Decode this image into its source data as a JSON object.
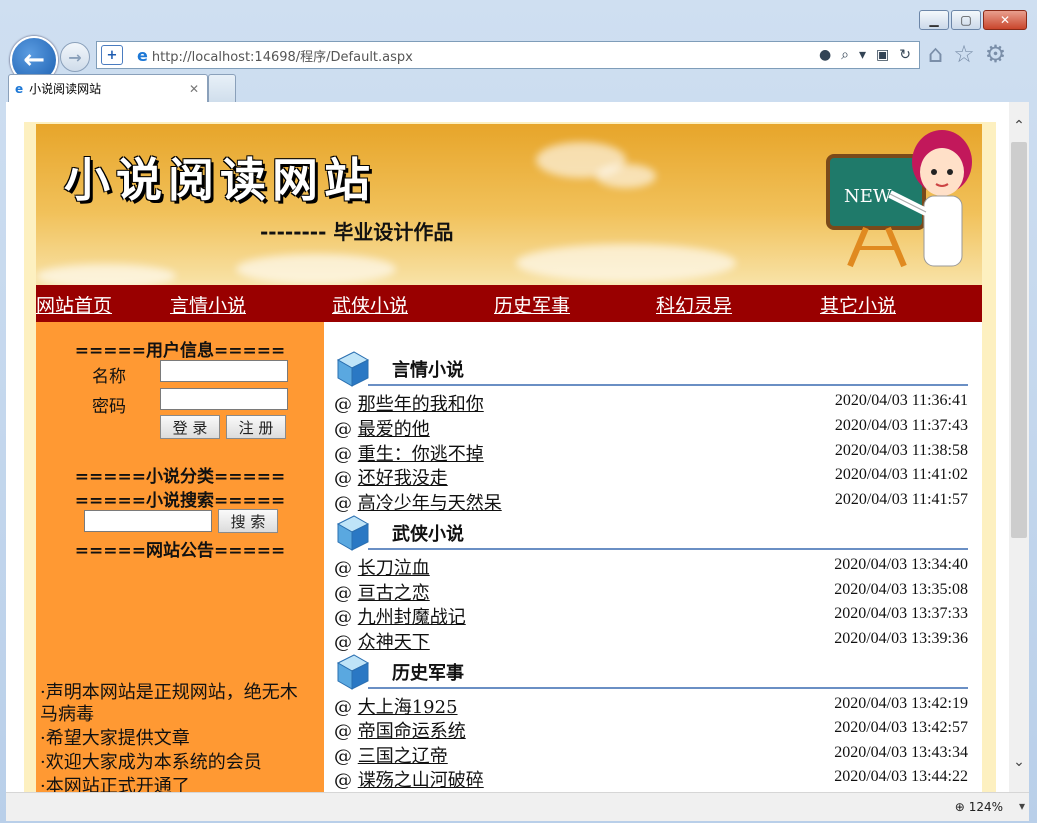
{
  "browser": {
    "url": "http://localhost:14698/程序/Default.aspx",
    "tab_title": "小说阅读网站",
    "zoom": "124%"
  },
  "site": {
    "title": "小说阅读网站",
    "subtitle": "-------- 毕业设计作品",
    "board_text": "NEW"
  },
  "menu": [
    "网站首页",
    "言情小说",
    "武侠小说",
    "历史军事",
    "科幻灵异",
    "其它小说"
  ],
  "sidebar": {
    "user_heading": "=====用户信息=====",
    "name_label": "名称",
    "password_label": "密码",
    "login_button": "登 录",
    "register_button": "注 册",
    "category_heading": "=====小说分类=====",
    "search_heading": "=====小说搜索=====",
    "search_button": "搜 索",
    "notice_heading": "=====网站公告=====",
    "notices": [
      "·声明本网站是正规网站，绝无木马病毒",
      "·希望大家提供文章",
      "·欢迎大家成为本系统的会员",
      "·本网站正式开通了"
    ]
  },
  "categories": [
    {
      "name": "言情小说",
      "items": [
        {
          "title": "那些年的我和你",
          "date": "2020/04/03 11:36:41"
        },
        {
          "title": "最爱的他",
          "date": "2020/04/03 11:37:43"
        },
        {
          "title": "重生：你逃不掉",
          "date": "2020/04/03 11:38:58"
        },
        {
          "title": "还好我没走",
          "date": "2020/04/03 11:41:02"
        },
        {
          "title": "高冷少年与天然呆",
          "date": "2020/04/03 11:41:57"
        }
      ]
    },
    {
      "name": "武侠小说",
      "items": [
        {
          "title": "长刀泣血",
          "date": "2020/04/03 13:34:40"
        },
        {
          "title": "亘古之恋",
          "date": "2020/04/03 13:35:08"
        },
        {
          "title": "九州封魔战记",
          "date": "2020/04/03 13:37:33"
        },
        {
          "title": "众神天下",
          "date": "2020/04/03 13:39:36"
        }
      ]
    },
    {
      "name": "历史军事",
      "items": [
        {
          "title": "大上海1925",
          "date": "2020/04/03 13:42:19"
        },
        {
          "title": "帝国命运系统",
          "date": "2020/04/03 13:42:57"
        },
        {
          "title": "三国之辽帝",
          "date": "2020/04/03 13:43:34"
        },
        {
          "title": "谍殇之山河破碎",
          "date": "2020/04/03 13:44:22"
        }
      ]
    }
  ],
  "row_prefix": "@ "
}
